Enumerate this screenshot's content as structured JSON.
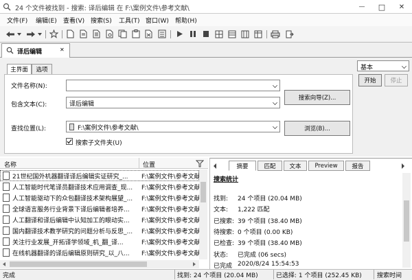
{
  "window": {
    "title": "24 个文件被找到 - 搜索: 译后编辑 在 F:\\案例文件\\参考文献\\",
    "minimize_label": "—",
    "maximize_label": "□",
    "close_label": "✕"
  },
  "menu": [
    "文件(F)",
    "编辑(E)",
    "查看(V)",
    "搜索(S)",
    "工具(T)",
    "窗口(W)",
    "帮助(H)"
  ],
  "doc_tab": {
    "label": "译后编辑",
    "close": "✕"
  },
  "subtabs": [
    "主界面",
    "选项"
  ],
  "form": {
    "file_name_label": "文件名称(N):",
    "file_name_value": "",
    "contains_text_label": "包含文本(C):",
    "contains_text_value": "译后编辑",
    "search_wizard_button": "搜索向导(Z)...",
    "look_in_label": "查找位置(L):",
    "look_in_value": "F:\\案例文件\\参考文献\\",
    "browse_button": "浏览(B)...",
    "subfolders_label": "搜索子文件夹(U)",
    "subfolders_checked": true
  },
  "right_panel": {
    "mode_value": "基本",
    "start_button": "开始",
    "stop_button": "停止"
  },
  "results": {
    "columns": [
      "名称",
      "位置"
    ],
    "rows": [
      {
        "name": "21世纪国外机器翻译译后编辑实证研究_...",
        "location": "F:\\案例文件\\参考文献"
      },
      {
        "name": "人工智能时代笔译员翻译技术应用调查_现...",
        "location": "F:\\案例文件\\参考文献"
      },
      {
        "name": "人工智能驱动下的众包翻译技术架构展望_...",
        "location": "F:\\案例文件\\参考文献"
      },
      {
        "name": "全球语言服务行业背景下译后编辑者培养...",
        "location": "F:\\案例文件\\参考文献"
      },
      {
        "name": "人工翻译和译后编辑中认知加工的眼动实...",
        "location": "F:\\案例文件\\参考文献"
      },
      {
        "name": "国内翻译技术教学研究的问题分析与反思_...",
        "location": "F:\\案例文件\\参考文献"
      },
      {
        "name": "关注行业发展_开拓译学领域_机_翻_译...",
        "location": "F:\\案例文件\\参考文献"
      },
      {
        "name": "在线机器翻译的译后编辑原则研究_以_八...",
        "location": "F:\\案例文件\\参考文献"
      }
    ]
  },
  "detail": {
    "tabs": [
      "摘要",
      "匹配",
      "文本",
      "Preview",
      "报告"
    ],
    "heading": "搜索统计",
    "stats": [
      {
        "key": "找到:",
        "value": "24 个项目 (20.04 MB)"
      },
      {
        "key": "文本:",
        "value": "1,222 匹配"
      },
      {
        "key": "已搜索:",
        "value": "39 个项目 (38.40 MB)"
      },
      {
        "key": "待搜索:",
        "value": "0 个项目 (0.00 KB)"
      },
      {
        "key": "已检查:",
        "value": "39 个项目 (38.40 MB)"
      },
      {
        "key": "状态:",
        "value": "已完成 (06 secs)"
      },
      {
        "key": "已完成",
        "value": "2020/8/24 15:54:53"
      }
    ]
  },
  "statusbar": {
    "left": "完成",
    "found": "找到: 24 个项目 (20.04 MB)",
    "selected": "已选择: 1 个项目 (252.45 KB)",
    "time": "搜索时间"
  }
}
